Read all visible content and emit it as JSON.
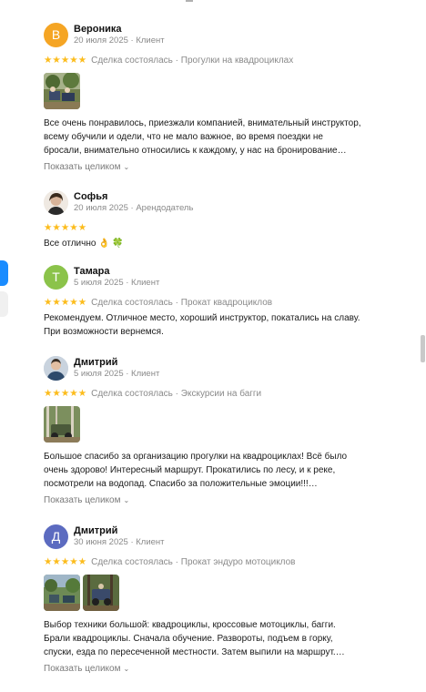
{
  "reviews": [
    {
      "name": "Вероника",
      "meta": "20 июля 2025 · Клиент",
      "avatar_letter": "В",
      "avatar_color": "#f5a524",
      "deal": "Сделка состоялась · Прогулки на квадроциклах",
      "text": "Все очень понравилось, приезжали компанией, внимательный инструктор,\nвсему обучили и одели, что не мало важное, во время поездки не\nбросали, внимательно относились к каждому, у нас на бронирование…",
      "more": "Показать целиком",
      "rating": 5
    },
    {
      "name": "Софья",
      "meta": "20 июля 2025 · Арендодатель",
      "avatar_letter": "",
      "avatar_color": "#5a4633",
      "deal": "",
      "text": "Все отлично 👌 🍀",
      "more": "",
      "rating": 5
    },
    {
      "name": "Тамара",
      "meta": "5 июля 2025 · Клиент",
      "avatar_letter": "Т",
      "avatar_color": "#8bc34a",
      "deal": "Сделка состоялась · Прокат квадроциклов",
      "text": "Рекомендуем. Отличное место, хороший инструктор, покатались на славу.\nПри возможности вернемся.",
      "more": "",
      "rating": 5
    },
    {
      "name": "Дмитрий",
      "meta": "5 июля 2025 · Клиент",
      "avatar_letter": "",
      "avatar_color": "#3b5573",
      "deal": "Сделка состоялась · Экскурсии на багги",
      "text": "Большое спасибо за организацию прогулки на квадроциклах! Всё было\nочень здорово! Интересный маршрут. Прокатились по лесу, и к реке,\nпосмотрели на водопад. Спасибо за положительные эмоции!!!…",
      "more": "Показать целиком",
      "rating": 5
    },
    {
      "name": "Дмитрий",
      "meta": "30 июня 2025 · Клиент",
      "avatar_letter": "Д",
      "avatar_color": "#5c6bc0",
      "deal": "Сделка состоялась · Прокат эндуро мотоциклов",
      "text": "Выбор техники большой: квадроциклы, кроссовые мотоциклы, багги.\nБрали квадроциклы. Сначала обучение. Развороты, подъем в горку,\nспуски, езда по пересеченной местности. Затем выпили на маршрут.…",
      "more": "Показать целиком",
      "rating": 5
    }
  ],
  "icons": {
    "star": "star-icon",
    "chevron": "chevron-down-icon"
  },
  "colors": {
    "star": "#fcbc1c",
    "accent": "#1a8cff"
  }
}
